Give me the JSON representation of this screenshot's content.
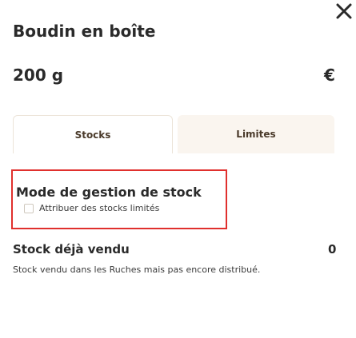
{
  "product": {
    "title": "Boudin en boîte",
    "quantity": "200 g",
    "currency": "€"
  },
  "tabs": [
    {
      "label": "Stocks",
      "active": true
    },
    {
      "label": "Limites",
      "active": false
    }
  ],
  "stock_mode": {
    "title": "Mode de gestion de stock",
    "checkbox_label": "Attribuer des stocks limités",
    "checked": false,
    "highlight_color": "#e0302d"
  },
  "stock_sold": {
    "title": "Stock déjà vendu",
    "description": "Stock vendu dans les Ruches mais pas encore distribué.",
    "value": "0"
  },
  "icons": {
    "close": "close-icon"
  }
}
